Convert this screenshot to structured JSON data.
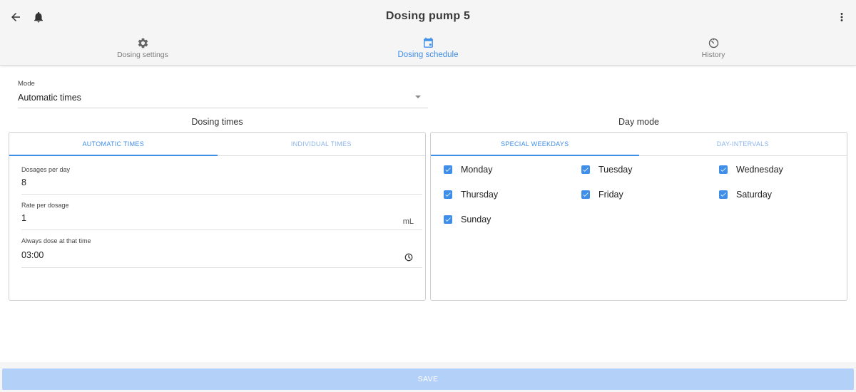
{
  "header": {
    "title": "Dosing pump 5",
    "back_icon": "arrow-back-icon",
    "bell_icon": "bell-icon",
    "more_icon": "more-vert-icon"
  },
  "nav_tabs": [
    {
      "label": "Dosing settings",
      "icon": "gear-icon",
      "active": false
    },
    {
      "label": "Dosing schedule",
      "icon": "calendar-icon",
      "active": true
    },
    {
      "label": "History",
      "icon": "history-icon",
      "active": false
    }
  ],
  "mode": {
    "label": "Mode",
    "value": "Automatic times"
  },
  "dosing_times": {
    "title": "Dosing times",
    "tabs": [
      {
        "label": "AUTOMATIC TIMES",
        "active": true
      },
      {
        "label": "INDIVIDUAL TIMES",
        "active": false
      }
    ],
    "fields": {
      "dosages": {
        "label": "Dosages per day",
        "value": "8"
      },
      "rate": {
        "label": "Rate per dosage",
        "value": "1",
        "unit": "mL"
      },
      "always": {
        "label": "Always dose at that time",
        "value": "03:00"
      }
    }
  },
  "day_mode": {
    "title": "Day mode",
    "tabs": [
      {
        "label": "SPECIAL WEEKDAYS",
        "active": true
      },
      {
        "label": "DAY-INTERVALS",
        "active": false
      }
    ],
    "days": [
      {
        "label": "Monday",
        "checked": true
      },
      {
        "label": "Tuesday",
        "checked": true
      },
      {
        "label": "Wednesday",
        "checked": true
      },
      {
        "label": "Thursday",
        "checked": true
      },
      {
        "label": "Friday",
        "checked": true
      },
      {
        "label": "Saturday",
        "checked": true
      },
      {
        "label": "Sunday",
        "checked": true
      }
    ]
  },
  "footer": {
    "save_label": "SAVE"
  },
  "colors": {
    "accent": "#3f8ee8",
    "save_disabled": "#b3d0f8",
    "header_bg": "#f5f5f5"
  }
}
